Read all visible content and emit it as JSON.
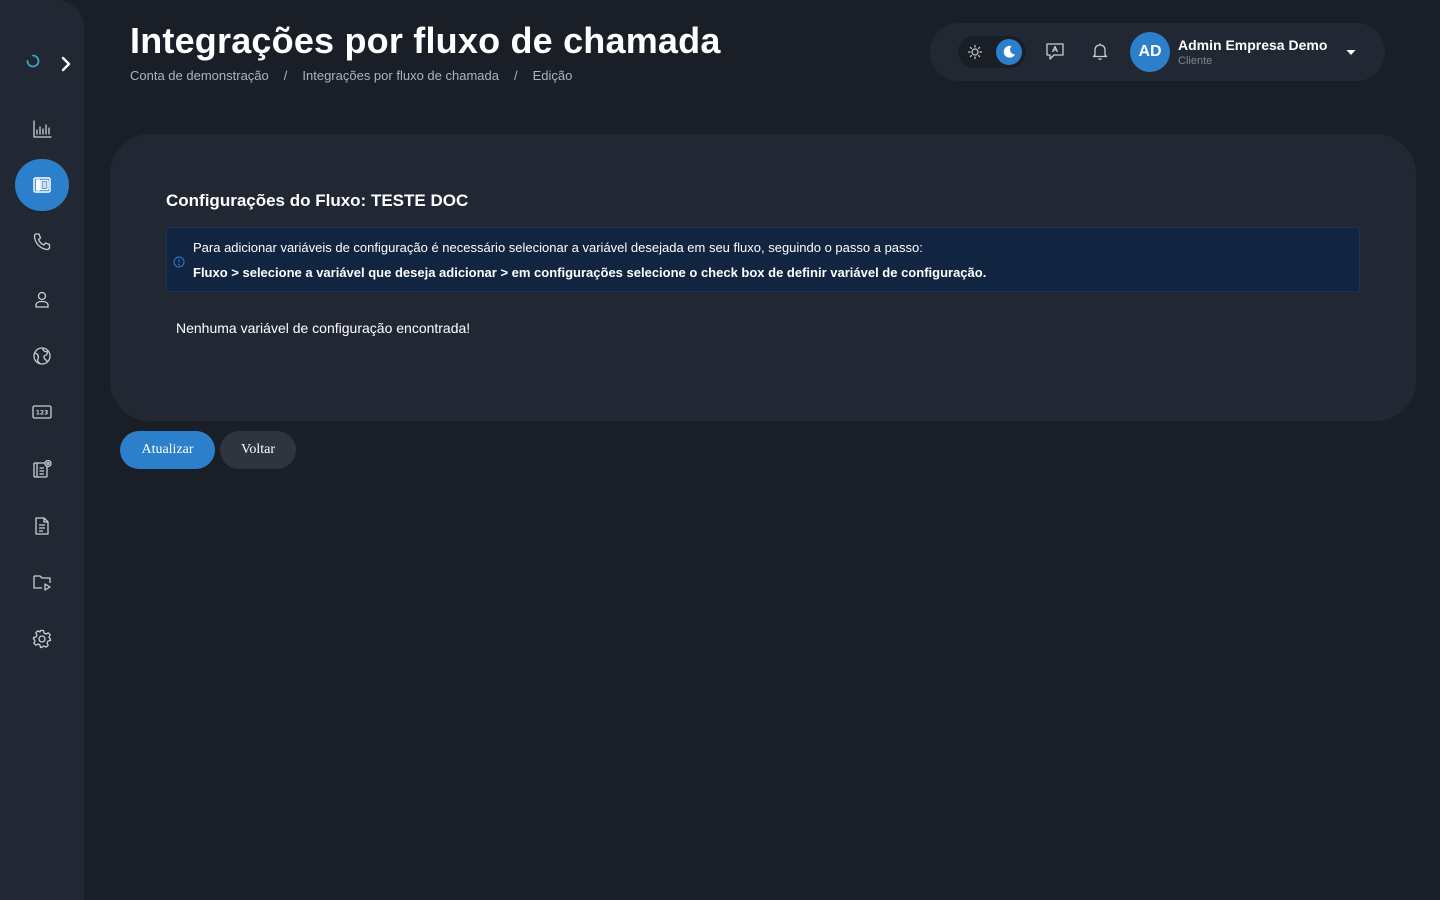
{
  "header": {
    "title": "Integrações por fluxo de chamada",
    "breadcrumb": [
      "Conta de demonstração",
      "Integrações por fluxo de chamada",
      "Edição"
    ],
    "breadcrumb_separator": "/"
  },
  "user": {
    "initials": "AD",
    "name": "Admin Empresa Demo",
    "role": "Cliente"
  },
  "sidebar": {
    "items": [
      {
        "icon": "chart-icon"
      },
      {
        "icon": "phonebook-icon",
        "active": true
      },
      {
        "icon": "phone-icon"
      },
      {
        "icon": "user-icon"
      },
      {
        "icon": "globe-icon"
      },
      {
        "icon": "numbers-icon"
      },
      {
        "icon": "integration-icon"
      },
      {
        "icon": "document-icon"
      },
      {
        "icon": "media-folder-icon"
      },
      {
        "icon": "gear-icon"
      }
    ]
  },
  "card": {
    "title": "Configurações do Fluxo: TESTE DOC",
    "alert_line1": "Para adicionar variáveis de configuração é necessário selecionar a variável desejada em seu fluxo, seguindo o passo a passo:",
    "alert_line2": "Fluxo > selecione a variável que deseja adicionar > em configurações selecione o check box de definir variável de configuração.",
    "empty_message": "Nenhuma variável de configuração encontrada!"
  },
  "actions": {
    "update_label": "Atualizar",
    "back_label": "Voltar"
  },
  "colors": {
    "background": "#1a1e26",
    "panel": "#222833",
    "accent": "#2b7fcb",
    "alert_bg": "#112440"
  }
}
